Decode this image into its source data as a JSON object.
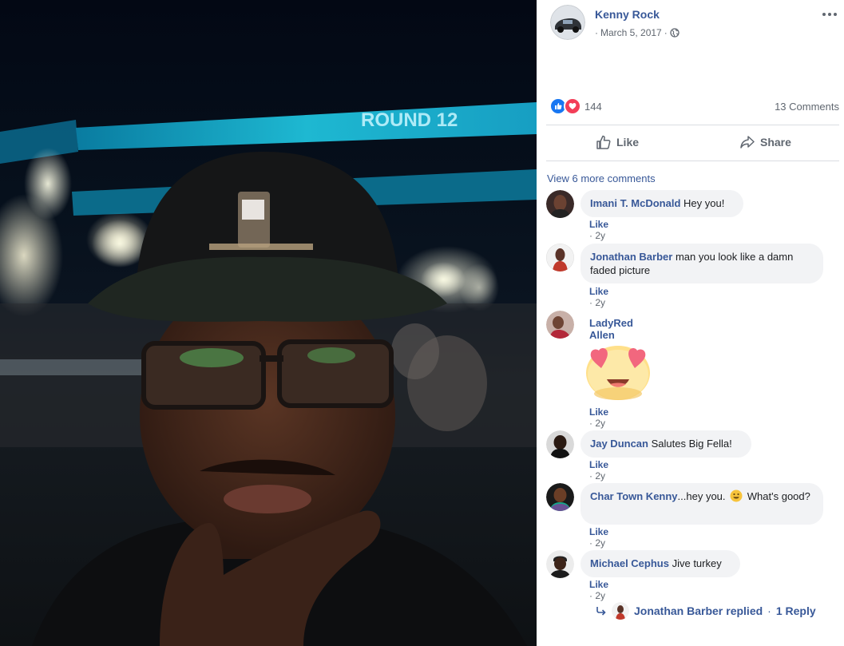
{
  "post": {
    "author": "Kenny Rock",
    "date": "March 5, 2017",
    "date_prefix": "·",
    "privacy_separator": "·",
    "privacy_icon": "globe-icon",
    "more_icon": "more-horizontal-icon",
    "reaction_count": "144",
    "reactions": [
      "like-reaction-icon",
      "love-reaction-icon"
    ],
    "comments_count": "13 Comments"
  },
  "actions": {
    "like": "Like",
    "share": "Share"
  },
  "view_more": "View 6 more comments",
  "photo_sign": "ROUND 12",
  "comments": [
    {
      "name": "Imani T. McDonald",
      "text": "Hey you!",
      "like": "Like",
      "sep": "·",
      "time": "2y"
    },
    {
      "name": "Jonathan Barber",
      "text": "man you look like a damn faded picture",
      "like": "Like",
      "sep": "·",
      "time": "2y"
    },
    {
      "name": "LadyRed Allen",
      "sticker": "heart-eyes-emoji",
      "like": "Like",
      "sep": "·",
      "time": "2y"
    },
    {
      "name": "Jay Duncan",
      "text": "Salutes Big Fella!",
      "like": "Like",
      "sep": "·",
      "time": "2y"
    },
    {
      "name": "Char Town Kenny",
      "text": "...hey you.",
      "emoji": "smiley-emoji",
      "text_after": "What's good?",
      "like": "Like",
      "sep": "·",
      "time": "2y"
    },
    {
      "name": "Michael Cephus",
      "text": "Jive turkey",
      "like": "Like",
      "sep": "·",
      "time": "2y"
    }
  ],
  "reply": {
    "name": "Jonathan Barber",
    "verb": "replied",
    "sep": "·",
    "count": "1 Reply"
  },
  "colors": {
    "link": "#385898",
    "meta": "#606770",
    "bubble": "#f2f3f5",
    "like_blue": "#1877f2",
    "love_red": "#f33e58",
    "arena_cyan": "#12c6e6"
  }
}
